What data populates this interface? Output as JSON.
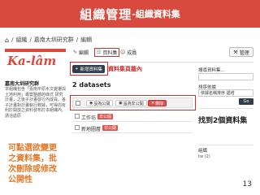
{
  "slide": {
    "title_main": "組織管理",
    "title_sub": "-組織資料集",
    "page_number": "13"
  },
  "breadcrumb": {
    "items": [
      "/",
      "組織",
      "/",
      "嘉南大圳研究群",
      "/",
      "編輯"
    ]
  },
  "sidebar": {
    "logo_text": "Ka-lâm",
    "org_name": "嘉南大圳研究群",
    "org_desc": "本組織包含「嘉南平原水文變遷與土地利用」專案整體的綠式 研究計畫，之後子計畫發行內成員。各子計畫對計畫執行數據，可得向有利於開放之資料發布於本組織內。請洽處原",
    "annotation": "可點選欲變更之資料集，批次刪除或修改公開性"
  },
  "toolbar": {
    "tab_edit": "編輯",
    "tab_datasets": "資料集",
    "tab_members": "成員",
    "admin_label": "管理"
  },
  "main": {
    "add_button": "新增資料集",
    "annotation_top": "資料集頁籤內",
    "dataset_count": "2 datasets",
    "bulk_public": "設為公開",
    "bulk_private": "設為非公開",
    "bulk_delete": "刪除",
    "datasets": [
      {
        "name": "工作坊",
        "badge": "非公開"
      },
      {
        "name": "新地圖層",
        "badge": "非公開"
      }
    ]
  },
  "right_panel": {
    "search_label": "搜尋資料集...",
    "search_placeholder": "",
    "sort_label": "排序依據",
    "sort_value": "依據名稱排序 遞增",
    "go_button": "Go",
    "annotation": "找到2個資料集",
    "filter_title": "組織",
    "filter_item": "tw (2)"
  }
}
